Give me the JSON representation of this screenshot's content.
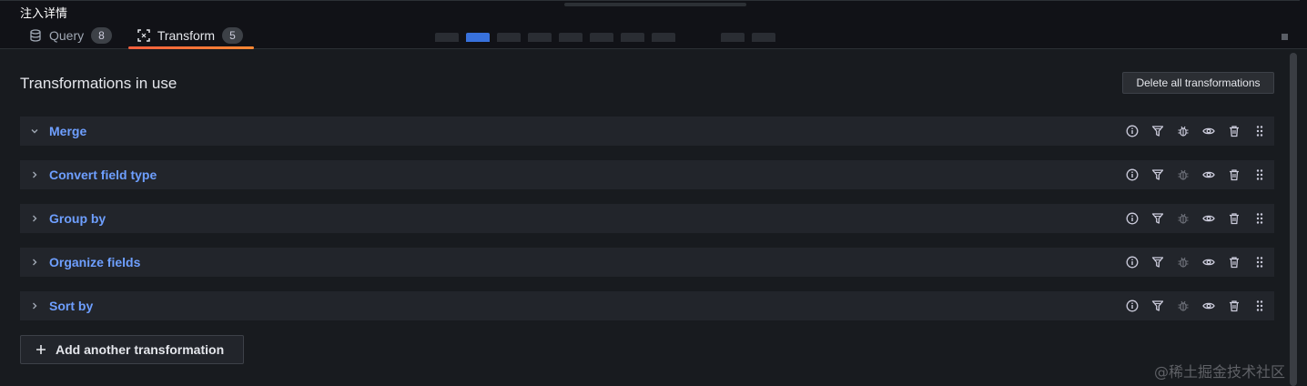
{
  "window_title": "注入详情",
  "tabs": [
    {
      "label": "Query",
      "count": "8",
      "icon": "database-icon"
    },
    {
      "label": "Transform",
      "count": "5",
      "icon": "transform-icon",
      "active": true
    }
  ],
  "panel": {
    "title": "Transformations in use",
    "delete_all_label": "Delete all transformations",
    "add_label": "Add another transformation"
  },
  "transformations": [
    {
      "name": "Merge",
      "expanded": true
    },
    {
      "name": "Convert field type",
      "expanded": false
    },
    {
      "name": "Group by",
      "expanded": false
    },
    {
      "name": "Organize fields",
      "expanded": false
    },
    {
      "name": "Sort by",
      "expanded": false
    }
  ],
  "row_actions": [
    "info-icon",
    "filter-icon",
    "debug-icon",
    "eye-icon",
    "trash-icon",
    "drag-icon"
  ],
  "watermark": "@稀土掘金技术社区",
  "colors": {
    "accent_link": "#6e9fff",
    "tab_underline": "#ff8833",
    "background": "#181b1f"
  }
}
